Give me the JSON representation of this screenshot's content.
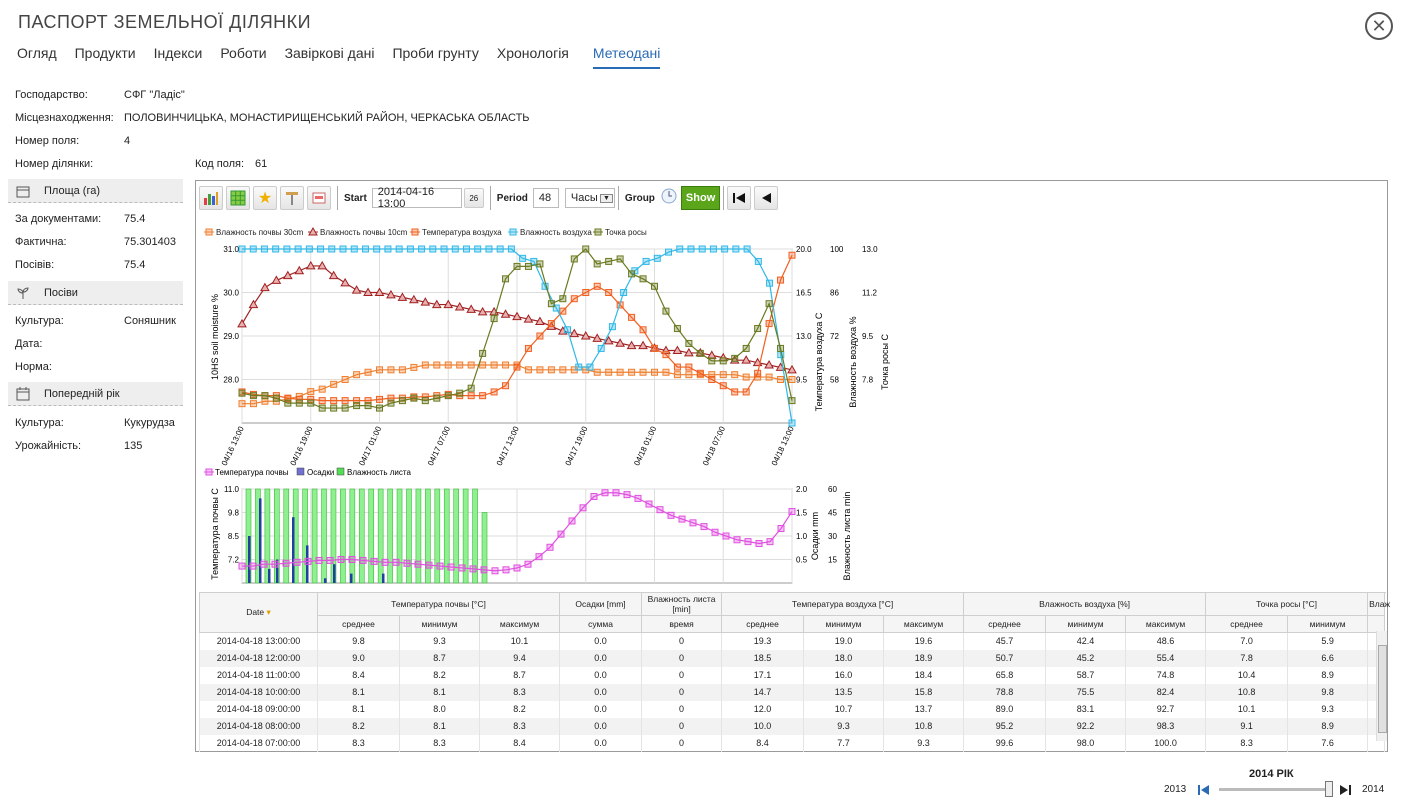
{
  "window": {
    "title": "ПАСПОРТ ЗЕМЕЛЬНОЇ ДІЛЯНКИ"
  },
  "tabs": [
    "Огляд",
    "Продукти",
    "Індекси",
    "Роботи",
    "Завіркові дані",
    "Проби грунту",
    "Хронологія",
    "Метеодані"
  ],
  "active_tab": "Метеодані",
  "info": {
    "farm_label": "Господарство:",
    "farm": "СФГ \"Ладіс\"",
    "location_label": "Місцезнаходження:",
    "location": "ПОЛОВИНЧИЦЬКА, МОНАСТИРИЩЕНСЬКИЙ РАЙОН, ЧЕРКАСЬКА ОБЛАСТЬ",
    "field_no_label": "Номер поля:",
    "field_no": "4",
    "plot_no_label": "Номер ділянки:",
    "field_code_label": "Код поля:",
    "field_code": "61"
  },
  "area": {
    "header": "Площа (га)",
    "doc_label": "За документами:",
    "doc": "75.4",
    "actual_label": "Фактична:",
    "actual": "75.301403",
    "sown_label": "Посівів:",
    "sown": "75.4"
  },
  "crops": {
    "header": "Посіви",
    "culture_label": "Культура:",
    "culture": "Соняшник",
    "date_label": "Дата:",
    "norm_label": "Норма:"
  },
  "prev_year": {
    "header": "Попередній рік",
    "culture_label": "Культура:",
    "culture": "Кукурудза",
    "yield_label": "Урожайність:",
    "yield": "135"
  },
  "toolbar": {
    "start_label": "Start",
    "start_value": "2014-04-16 13:00",
    "calendar_day": "26",
    "period_label": "Period",
    "period_value": "48",
    "unit": "Часы",
    "group_label": "Group",
    "show_label": "Show"
  },
  "chart_data": [
    {
      "type": "line",
      "legend": [
        "Влажность почвы 30cm",
        "Влажность почвы 10cm",
        "Температура воздуха",
        "Влажность воздуха",
        "Точка росы"
      ],
      "x_ticks": [
        "04/16 13:00",
        "04/16 19:00",
        "04/17 01:00",
        "04/17 07:00",
        "04/17 13:00",
        "04/17 19:00",
        "04/18 01:00",
        "04/18 07:00",
        "04/18 13:00"
      ],
      "left_axis": {
        "label": "10HS soil moisture %",
        "ticks": [
          "31.0",
          "30.0",
          "29.0",
          "28.0"
        ],
        "range": [
          27.4,
          31.0
        ]
      },
      "right_axes": [
        {
          "label": "Температура воздуха С",
          "ticks": [
            "20.0",
            "16.5",
            "13.0",
            "9.5"
          ],
          "range": [
            6.0,
            20.0
          ]
        },
        {
          "label": "Влажность воздуха %",
          "ticks": [
            "100",
            "86",
            "72",
            "58"
          ],
          "range": [
            44,
            100
          ]
        },
        {
          "label": "Точка росы С",
          "ticks": [
            "13.0",
            "11.2",
            "9.5",
            "7.8"
          ],
          "range": [
            6.0,
            13.0
          ]
        }
      ],
      "series": [
        {
          "name": "Влажность почвы 30cm",
          "axis": 0,
          "color": "#f08030",
          "values": [
            27.8,
            27.8,
            27.85,
            27.85,
            27.9,
            27.95,
            28.05,
            28.1,
            28.2,
            28.3,
            28.4,
            28.45,
            28.5,
            28.5,
            28.5,
            28.55,
            28.6,
            28.6,
            28.6,
            28.6,
            28.6,
            28.6,
            28.6,
            28.6,
            28.6,
            28.5,
            28.5,
            28.5,
            28.5,
            28.5,
            28.5,
            28.45,
            28.45,
            28.45,
            28.45,
            28.45,
            28.45,
            28.45,
            28.4,
            28.4,
            28.4,
            28.4,
            28.4,
            28.4,
            28.35,
            28.35,
            28.35,
            28.3,
            28.3
          ]
        },
        {
          "name": "Влажность почвы 10cm",
          "axis": 0,
          "color": "#a02020",
          "values": [
            29.45,
            29.85,
            30.2,
            30.35,
            30.45,
            30.55,
            30.65,
            30.65,
            30.45,
            30.3,
            30.15,
            30.1,
            30.1,
            30.05,
            30.0,
            29.95,
            29.9,
            29.85,
            29.85,
            29.8,
            29.75,
            29.7,
            29.7,
            29.65,
            29.6,
            29.55,
            29.5,
            29.4,
            29.3,
            29.25,
            29.2,
            29.15,
            29.1,
            29.05,
            29.0,
            29.0,
            28.95,
            28.9,
            28.9,
            28.85,
            28.85,
            28.8,
            28.75,
            28.7,
            28.7,
            28.65,
            28.6,
            28.55,
            28.5
          ]
        },
        {
          "name": "Температура воздуха",
          "axis": 1,
          "color": "#f06020",
          "values": [
            8.5,
            8.3,
            8.2,
            8.2,
            8.0,
            7.9,
            7.9,
            7.8,
            7.8,
            7.8,
            7.8,
            7.8,
            7.9,
            8.0,
            8.0,
            8.1,
            8.1,
            8.2,
            8.3,
            8.2,
            8.2,
            8.2,
            8.5,
            9.0,
            10.5,
            12.0,
            13.0,
            14.0,
            15.0,
            16.0,
            16.5,
            17.0,
            16.5,
            15.5,
            14.5,
            13.5,
            12.0,
            11.5,
            10.5,
            10.5,
            10.0,
            9.5,
            9.0,
            8.5,
            8.5,
            10.0,
            14.0,
            17.5,
            19.5
          ]
        },
        {
          "name": "Влажность воздуха",
          "axis": 2,
          "color": "#30b8e8",
          "values": [
            100,
            100,
            100,
            100,
            100,
            100,
            100,
            100,
            100,
            100,
            100,
            100,
            100,
            100,
            100,
            100,
            100,
            100,
            100,
            100,
            100,
            100,
            100,
            100,
            100,
            97,
            96,
            88,
            81,
            74,
            62,
            62,
            68,
            75,
            86,
            93,
            96,
            97,
            99,
            100,
            100,
            100,
            100,
            100,
            100,
            100,
            96,
            89,
            66,
            44
          ]
        },
        {
          "name": "Точка росы",
          "axis": 3,
          "color": "#6a7a20",
          "values": [
            7.2,
            7.1,
            7.1,
            7.0,
            6.8,
            6.8,
            6.8,
            6.6,
            6.6,
            6.6,
            6.7,
            6.7,
            6.6,
            6.8,
            6.9,
            7.0,
            6.9,
            7.0,
            7.1,
            7.2,
            7.4,
            8.8,
            10.2,
            11.8,
            12.3,
            12.3,
            12.4,
            10.8,
            11.0,
            12.6,
            13.0,
            12.4,
            12.5,
            12.6,
            12.0,
            11.8,
            11.5,
            10.5,
            9.8,
            9.2,
            8.8,
            8.5,
            8.5,
            8.6,
            9.0,
            9.8,
            10.8,
            9.0,
            6.9
          ]
        }
      ]
    },
    {
      "type": "bar",
      "legend": [
        "Температура почвы",
        "Осадки",
        "Влажность листа"
      ],
      "left_axis": {
        "label": "Температура почвы С",
        "ticks": [
          "11.0",
          "9.8",
          "8.5",
          "7.2"
        ],
        "range": [
          6.0,
          11.0
        ]
      },
      "right_axes": [
        {
          "label": "Осадки mm",
          "ticks": [
            "2.0",
            "1.5",
            "1.0",
            "0.5"
          ],
          "range": [
            0,
            2.0
          ]
        },
        {
          "label": "Влажность листа min",
          "ticks": [
            "60",
            "45",
            "30",
            "15"
          ],
          "range": [
            0,
            60
          ]
        }
      ],
      "series": [
        {
          "name": "Температура почвы",
          "axis": 0,
          "color": "#e050e0",
          "values": [
            6.9,
            6.9,
            7.0,
            7.0,
            7.05,
            7.1,
            7.15,
            7.2,
            7.2,
            7.25,
            7.25,
            7.2,
            7.15,
            7.1,
            7.1,
            7.05,
            7.0,
            6.95,
            6.9,
            6.85,
            6.8,
            6.75,
            6.7,
            6.65,
            6.7,
            6.8,
            7.0,
            7.4,
            7.9,
            8.6,
            9.3,
            10.0,
            10.6,
            10.8,
            10.8,
            10.7,
            10.5,
            10.2,
            9.9,
            9.6,
            9.4,
            9.2,
            9.0,
            8.7,
            8.5,
            8.3,
            8.2,
            8.1,
            8.2,
            8.9,
            9.8
          ]
        },
        {
          "name": "Осадки",
          "axis": 1,
          "color": "#2040a0",
          "values": [
            1.0,
            1.8,
            0.3,
            0.5,
            1.4,
            0.8,
            0.1,
            0.4,
            0.2,
            0.2
          ]
        },
        {
          "name": "Влажность листа",
          "axis": 2,
          "color": "#55dd55",
          "values": [
            60,
            60,
            60,
            60,
            60,
            60,
            60,
            60,
            60,
            60,
            60,
            60,
            60,
            60,
            60,
            60,
            60,
            60,
            60,
            60,
            60,
            60,
            60,
            60,
            60,
            45
          ]
        }
      ]
    }
  ],
  "table": {
    "group_headers": [
      "Температура почвы [°C]",
      "Осадки [mm]",
      "Влажность листа [min]",
      "Температура воздуха [°C]",
      "Влажность воздуха [%]",
      "Точка росы [°C]",
      "Влаж"
    ],
    "date_header": "Date",
    "sub_headers": [
      "среднее",
      "минимум",
      "максимум",
      "сумма",
      "время",
      "среднее",
      "минимум",
      "максимум",
      "среднее",
      "минимум",
      "максимум",
      "среднее",
      "минимум"
    ],
    "rows": [
      [
        "2014-04-18 13:00:00",
        "9.8",
        "9.3",
        "10.1",
        "0.0",
        "0",
        "19.3",
        "19.0",
        "19.6",
        "45.7",
        "42.4",
        "48.6",
        "7.0",
        "5.9"
      ],
      [
        "2014-04-18 12:00:00",
        "9.0",
        "8.7",
        "9.4",
        "0.0",
        "0",
        "18.5",
        "18.0",
        "18.9",
        "50.7",
        "45.2",
        "55.4",
        "7.8",
        "6.6"
      ],
      [
        "2014-04-18 11:00:00",
        "8.4",
        "8.2",
        "8.7",
        "0.0",
        "0",
        "17.1",
        "16.0",
        "18.4",
        "65.8",
        "58.7",
        "74.8",
        "10.4",
        "8.9"
      ],
      [
        "2014-04-18 10:00:00",
        "8.1",
        "8.1",
        "8.3",
        "0.0",
        "0",
        "14.7",
        "13.5",
        "15.8",
        "78.8",
        "75.5",
        "82.4",
        "10.8",
        "9.8"
      ],
      [
        "2014-04-18 09:00:00",
        "8.1",
        "8.0",
        "8.2",
        "0.0",
        "0",
        "12.0",
        "10.7",
        "13.7",
        "89.0",
        "83.1",
        "92.7",
        "10.1",
        "9.3"
      ],
      [
        "2014-04-18 08:00:00",
        "8.2",
        "8.1",
        "8.3",
        "0.0",
        "0",
        "10.0",
        "9.3",
        "10.8",
        "95.2",
        "92.2",
        "98.3",
        "9.1",
        "8.9"
      ],
      [
        "2014-04-18 07:00:00",
        "8.3",
        "8.3",
        "8.4",
        "0.0",
        "0",
        "8.4",
        "7.7",
        "9.3",
        "99.6",
        "98.0",
        "100.0",
        "8.3",
        "7.6"
      ]
    ]
  },
  "year_slider": {
    "caption": "2014 РІК",
    "from": "2013",
    "to": "2014"
  },
  "colors": {
    "accent": "#2a6bb5",
    "show_button": "#5aa51a"
  }
}
